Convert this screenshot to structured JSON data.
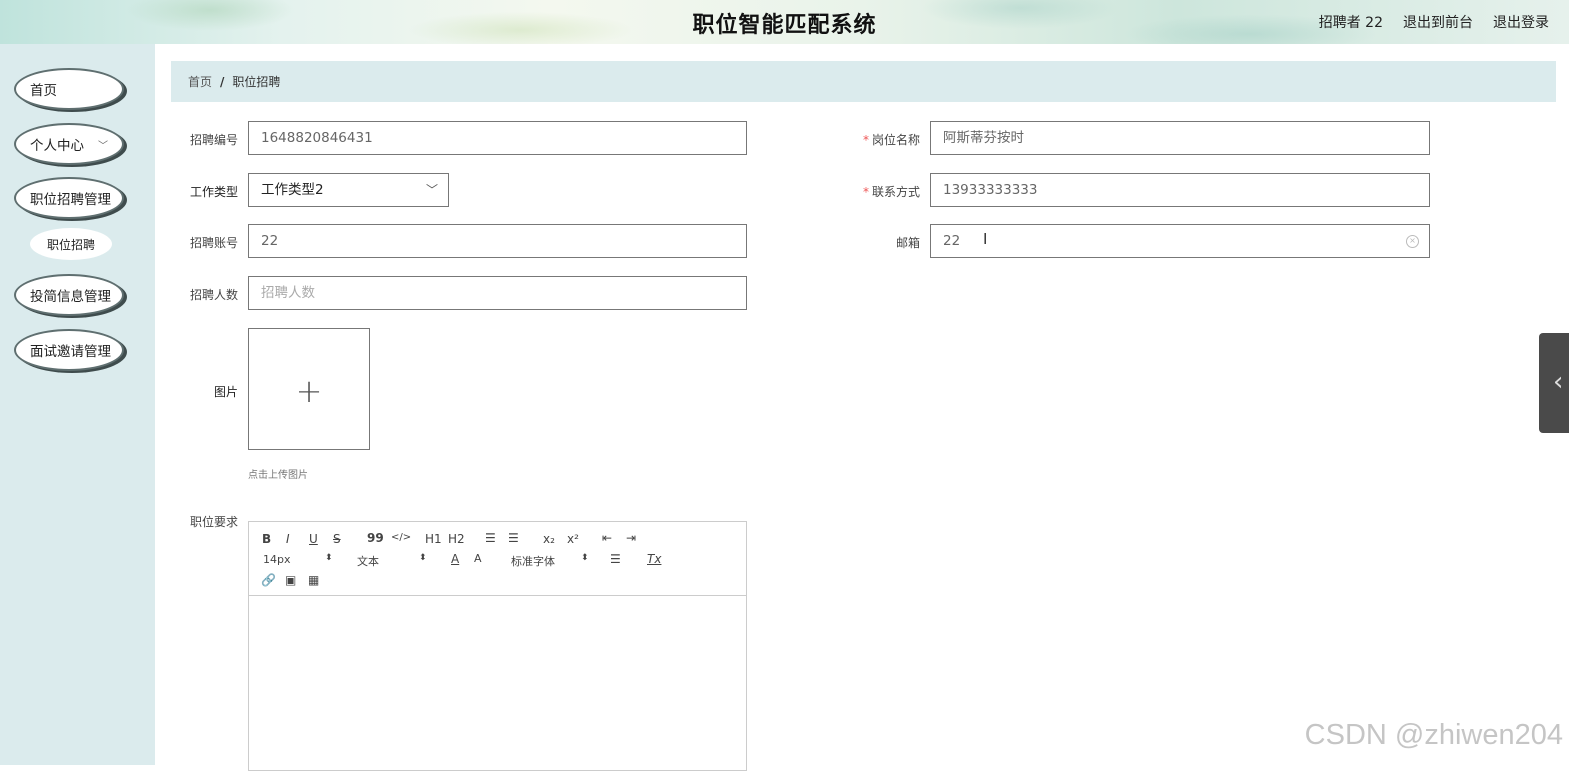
{
  "header": {
    "title": "职位智能匹配系统",
    "user": "招聘者 22",
    "back_front": "退出到前台",
    "logout": "退出登录"
  },
  "sidebar": {
    "items": [
      {
        "label": "首页"
      },
      {
        "label": "个人中心"
      },
      {
        "label": "职位招聘管理"
      },
      {
        "label": "职位招聘"
      },
      {
        "label": "投简信息管理"
      },
      {
        "label": "面试邀请管理"
      }
    ]
  },
  "breadcrumb": {
    "home": "首页",
    "separator": "/",
    "current": "职位招聘"
  },
  "form": {
    "recruit_no": {
      "label": "招聘编号",
      "value": "1648820846431"
    },
    "job_name": {
      "required": "*",
      "label": "岗位名称",
      "value": "阿斯蒂芬按时"
    },
    "work_type": {
      "label": "工作类型",
      "value": "工作类型2"
    },
    "contact": {
      "required": "*",
      "label": "联系方式",
      "value": "13933333333"
    },
    "account": {
      "label": "招聘账号",
      "value": "22"
    },
    "email": {
      "label": "邮箱",
      "value": "22"
    },
    "headcount": {
      "label": "招聘人数",
      "placeholder": "招聘人数"
    },
    "image": {
      "label": "图片",
      "tip": "点击上传图片"
    },
    "requirement": {
      "label": "职位要求"
    }
  },
  "editor": {
    "bold": "B",
    "italic": "I",
    "underline": "U",
    "strike": "S",
    "quote": "99",
    "code": "</>",
    "h1": "H1",
    "h2": "H2",
    "sub": "x₂",
    "sup": "x²",
    "clean": "Tx",
    "color": "A",
    "background": "A",
    "size": "14px",
    "header": "文本",
    "font": "标准字体"
  },
  "watermark": "CSDN @zhiwen204"
}
